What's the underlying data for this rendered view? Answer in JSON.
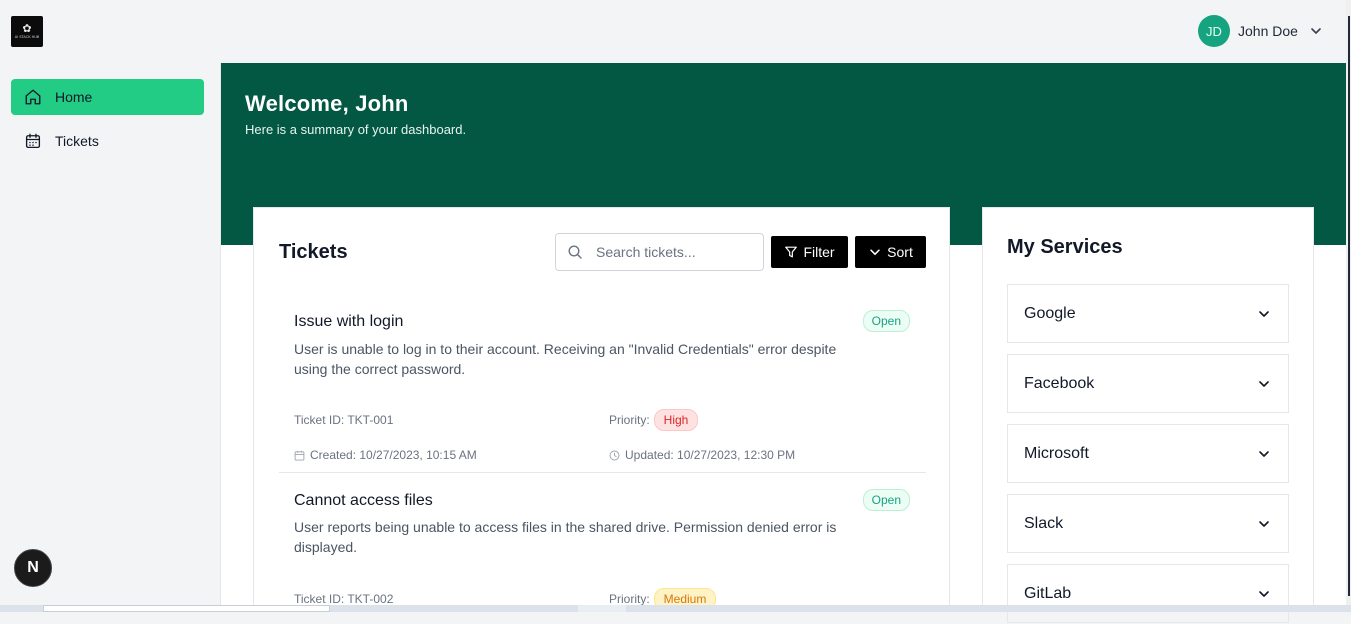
{
  "header": {
    "logo_text": "AI STACK HUB",
    "user": {
      "initials": "JD",
      "name": "John Doe"
    }
  },
  "sidebar": {
    "items": [
      {
        "label": "Home",
        "icon": "home-icon",
        "active": true
      },
      {
        "label": "Tickets",
        "icon": "calendar-icon",
        "active": false
      }
    ]
  },
  "hero": {
    "title": "Welcome, John",
    "subtitle": "Here is a summary of your dashboard."
  },
  "tickets_panel": {
    "title": "Tickets",
    "search_placeholder": "Search tickets...",
    "filter_label": "Filter",
    "sort_label": "Sort",
    "tickets": [
      {
        "title": "Issue with login",
        "status": "Open",
        "description": "User is unable to log in to their account. Receiving an \"Invalid Credentials\" error despite using the correct password.",
        "ticket_id": "Ticket ID: TKT-001",
        "priority_label": "Priority:",
        "priority": "High",
        "created": "Created: 10/27/2023, 10:15 AM",
        "updated": "Updated: 10/27/2023, 12:30 PM"
      },
      {
        "title": "Cannot access files",
        "status": "Open",
        "description": "User reports being unable to access files in the shared drive. Permission denied error is displayed.",
        "ticket_id": "Ticket ID: TKT-002",
        "priority_label": "Priority:",
        "priority": "Medium"
      }
    ]
  },
  "services_panel": {
    "title": "My Services",
    "services": [
      "Google",
      "Facebook",
      "Microsoft",
      "Slack",
      "GitLab"
    ]
  },
  "dev_badge": {
    "label": "N"
  },
  "colors": {
    "brand_green": "#035843",
    "accent_green": "#22cc84",
    "high": "#dc2626",
    "medium": "#d97706",
    "open": "#16a37f"
  }
}
